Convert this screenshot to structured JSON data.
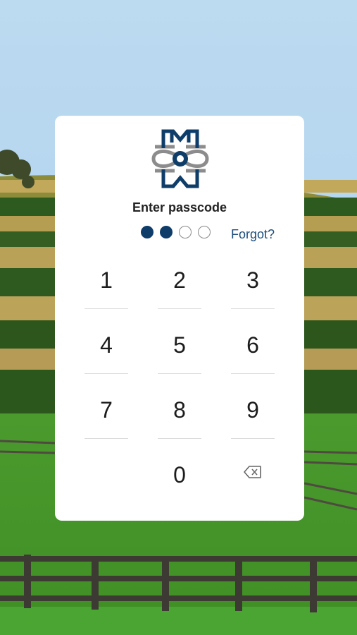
{
  "colors": {
    "accent": "#0e3d6a",
    "logo_gray": "#8c8c8c",
    "link": "#1b4d7b"
  },
  "passcode": {
    "title": "Enter passcode",
    "forgot_label": "Forgot?",
    "length": 4,
    "entered": 2
  },
  "keypad": {
    "keys": [
      "1",
      "2",
      "3",
      "4",
      "5",
      "6",
      "7",
      "8",
      "9",
      "0"
    ],
    "delete_icon": "backspace-icon"
  },
  "logo": {
    "icon": "monogram-logo"
  }
}
